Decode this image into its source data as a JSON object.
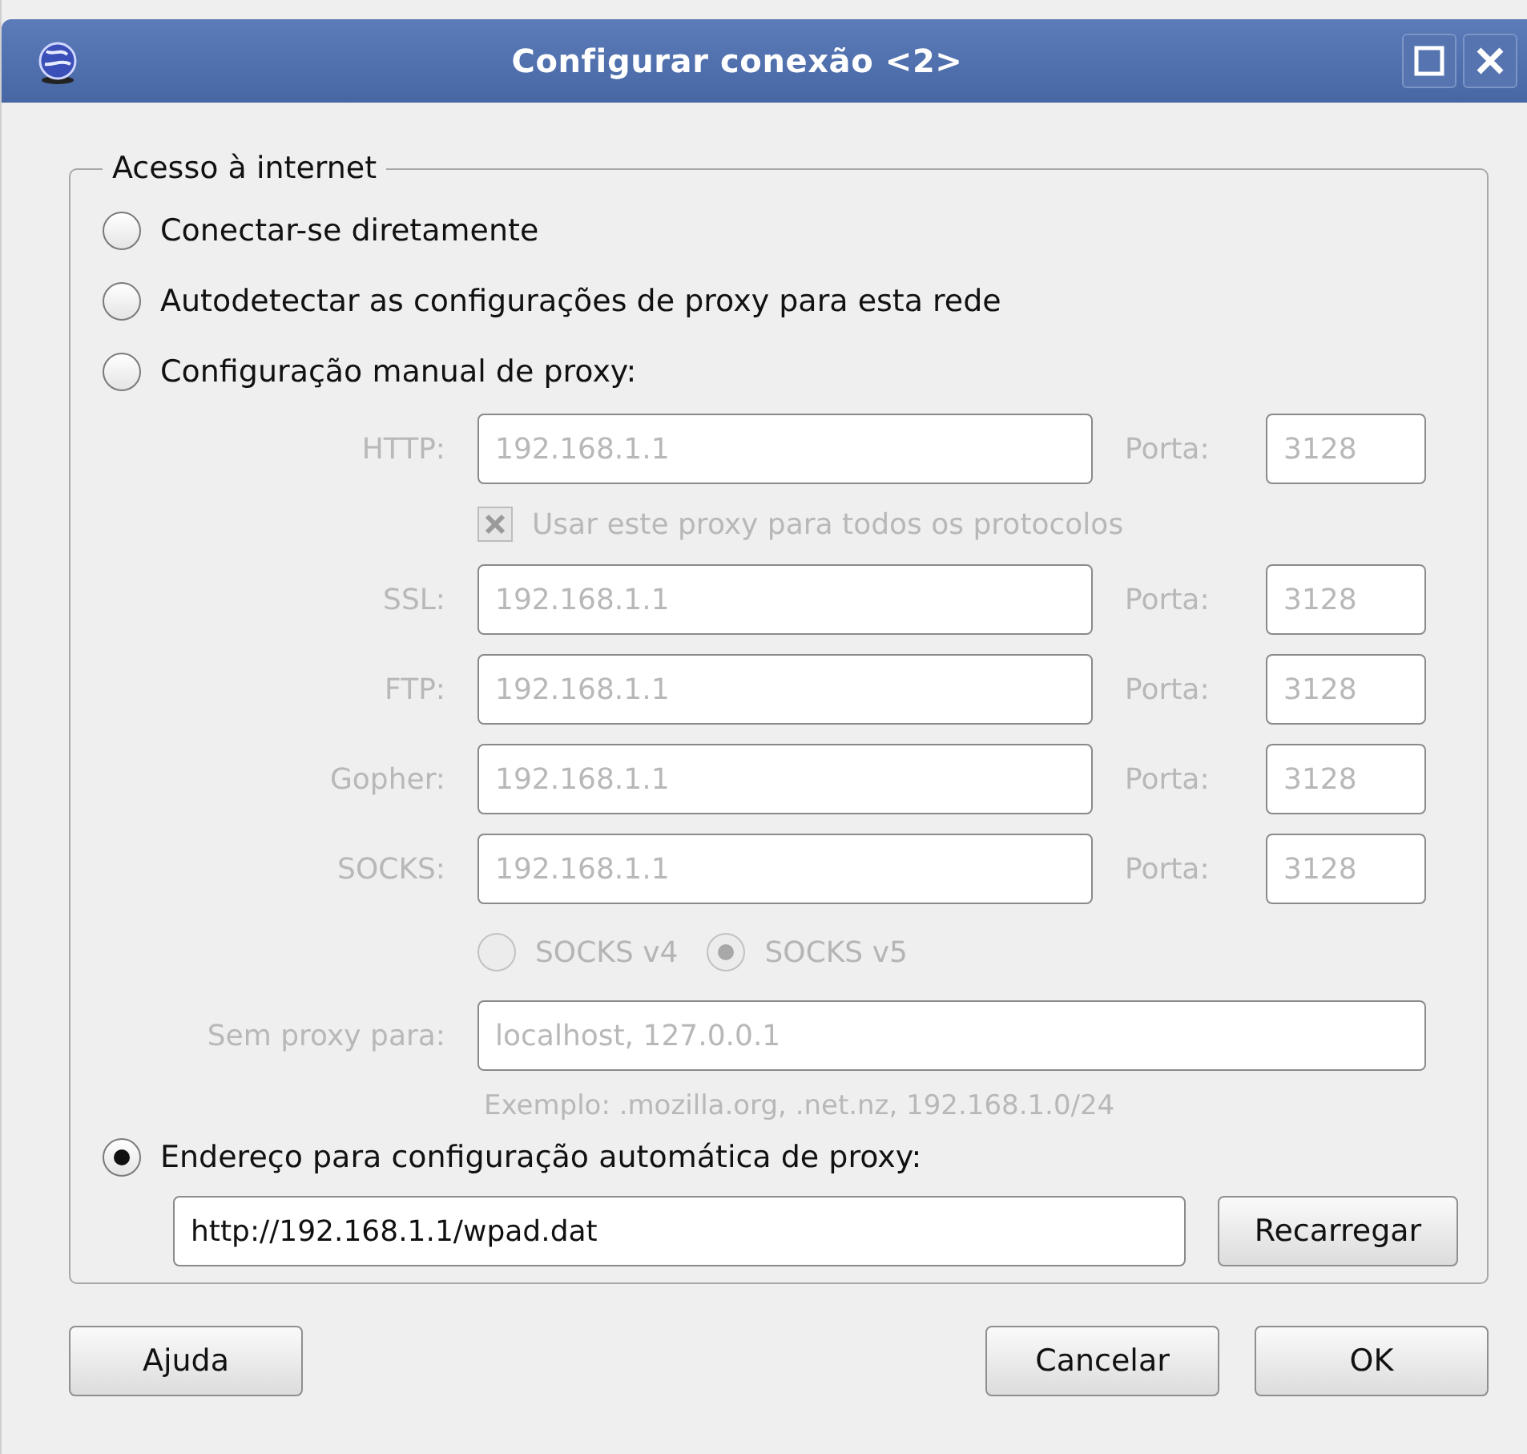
{
  "window": {
    "title": "Configurar conexão <2>"
  },
  "group": {
    "legend": "Acesso à internet"
  },
  "modes": [
    {
      "kind": "plain",
      "label": "Conectar-se diretamente",
      "selected": false
    },
    {
      "kind": "plain",
      "label": "Autodetectar as configurações de proxy para esta rede",
      "selected": false
    },
    {
      "kind": "manual",
      "label": "Configuração manual de proxy:",
      "selected": false
    },
    {
      "kind": "auto",
      "label": "Endereço para configuração automática de proxy:",
      "selected": true
    }
  ],
  "manual": {
    "disabled": true,
    "proxies": [
      {
        "label": "HTTP:",
        "value": "192.168.1.1",
        "port_label": "Porta:",
        "port": "3128"
      },
      {
        "label": "SSL:",
        "value": "192.168.1.1",
        "port_label": "Porta:",
        "port": "3128"
      },
      {
        "label": "FTP:",
        "value": "192.168.1.1",
        "port_label": "Porta:",
        "port": "3128"
      },
      {
        "label": "Gopher:",
        "value": "192.168.1.1",
        "port_label": "Porta:",
        "port": "3128"
      },
      {
        "label": "SOCKS:",
        "value": "192.168.1.1",
        "port_label": "Porta:",
        "port": "3128"
      }
    ],
    "share_all": {
      "label": "Usar este proxy para todos os protocolos",
      "checked": true
    },
    "socks_versions": [
      {
        "label": "SOCKS v4",
        "selected": false
      },
      {
        "label": "SOCKS v5",
        "selected": true
      }
    ],
    "no_proxy": {
      "label": "Sem proxy para:",
      "value": "localhost, 127.0.0.1"
    },
    "example": "Exemplo: .mozilla.org, .net.nz, 192.168.1.0/24"
  },
  "auto": {
    "url": "http://192.168.1.1/wpad.dat",
    "reload_button": {
      "label": "Recarregar"
    }
  },
  "buttons": [
    {
      "kind": "help",
      "label": "Ajuda"
    },
    {
      "kind": "cancel",
      "label": "Cancelar"
    },
    {
      "kind": "ok",
      "label": "OK"
    }
  ]
}
